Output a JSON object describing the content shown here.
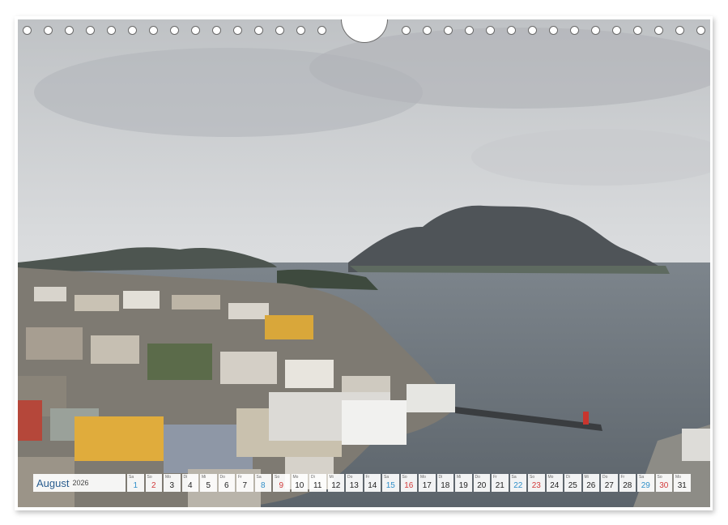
{
  "calendar": {
    "month": "August",
    "year": "2026",
    "days": [
      {
        "n": "1",
        "dow": "Sa",
        "type": "weekend"
      },
      {
        "n": "2",
        "dow": "So",
        "type": "sunday"
      },
      {
        "n": "3",
        "dow": "Mo",
        "type": "weekday"
      },
      {
        "n": "4",
        "dow": "Di",
        "type": "weekday"
      },
      {
        "n": "5",
        "dow": "Mi",
        "type": "weekday"
      },
      {
        "n": "6",
        "dow": "Do",
        "type": "weekday"
      },
      {
        "n": "7",
        "dow": "Fr",
        "type": "weekday"
      },
      {
        "n": "8",
        "dow": "Sa",
        "type": "weekend"
      },
      {
        "n": "9",
        "dow": "So",
        "type": "sunday"
      },
      {
        "n": "10",
        "dow": "Mo",
        "type": "weekday"
      },
      {
        "n": "11",
        "dow": "Di",
        "type": "weekday"
      },
      {
        "n": "12",
        "dow": "Mi",
        "type": "weekday"
      },
      {
        "n": "13",
        "dow": "Do",
        "type": "weekday"
      },
      {
        "n": "14",
        "dow": "Fr",
        "type": "weekday"
      },
      {
        "n": "15",
        "dow": "Sa",
        "type": "weekend"
      },
      {
        "n": "16",
        "dow": "So",
        "type": "sunday"
      },
      {
        "n": "17",
        "dow": "Mo",
        "type": "weekday"
      },
      {
        "n": "18",
        "dow": "Di",
        "type": "weekday"
      },
      {
        "n": "19",
        "dow": "Mi",
        "type": "weekday"
      },
      {
        "n": "20",
        "dow": "Do",
        "type": "weekday"
      },
      {
        "n": "21",
        "dow": "Fr",
        "type": "weekday"
      },
      {
        "n": "22",
        "dow": "Sa",
        "type": "weekend"
      },
      {
        "n": "23",
        "dow": "So",
        "type": "sunday"
      },
      {
        "n": "24",
        "dow": "Mo",
        "type": "weekday"
      },
      {
        "n": "25",
        "dow": "Di",
        "type": "weekday"
      },
      {
        "n": "26",
        "dow": "Mi",
        "type": "weekday"
      },
      {
        "n": "27",
        "dow": "Do",
        "type": "weekday"
      },
      {
        "n": "28",
        "dow": "Fr",
        "type": "weekday"
      },
      {
        "n": "29",
        "dow": "Sa",
        "type": "weekend"
      },
      {
        "n": "30",
        "dow": "So",
        "type": "sunday"
      },
      {
        "n": "31",
        "dow": "Mo",
        "type": "weekday"
      }
    ]
  },
  "colors": {
    "weekend": "#2f8fc9",
    "sunday": "#d23a3a",
    "month_label": "#2a5d8f"
  },
  "photo": {
    "subject": "harbor-town-panorama-photo"
  }
}
